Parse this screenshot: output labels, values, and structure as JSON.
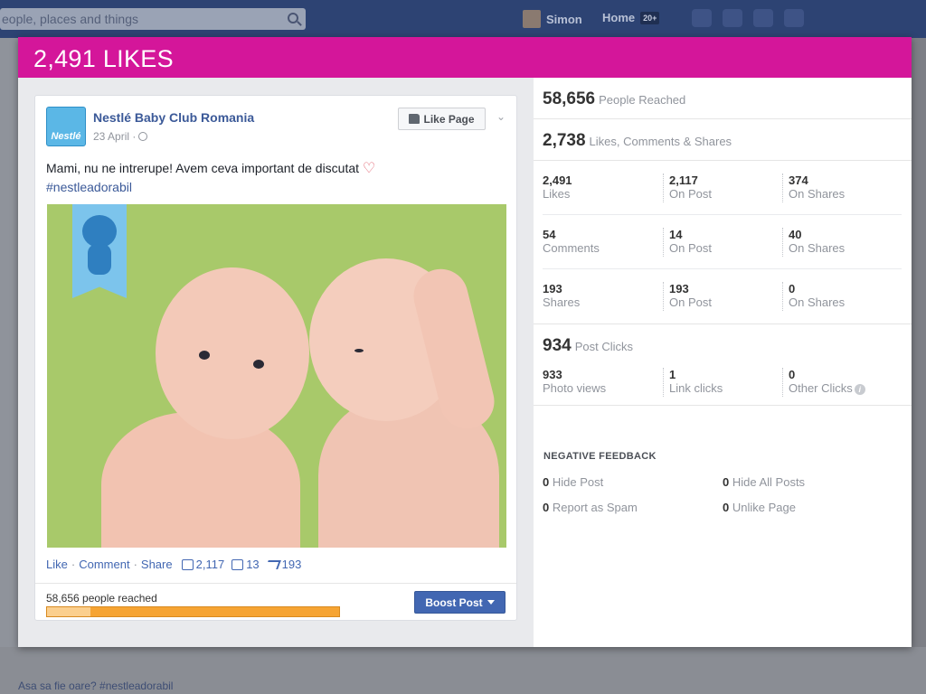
{
  "topbar": {
    "search_placeholder": "eople, places and things",
    "user_name": "Simon",
    "home_label": "Home",
    "home_badge": "20+"
  },
  "background": {
    "bottom_text": "Asa sa fie oare? #nestleadorabil"
  },
  "overlay": {
    "title": "2,491 LIKES"
  },
  "post": {
    "page_name": "Nestlé Baby Club Romania",
    "logo_text": "Nestlé",
    "date": "23 April ·",
    "like_page_label": "Like Page",
    "message": "Mami, nu ne intrerupe! Avem ceva important de discutat",
    "hashtag": "#nestleadorabil",
    "actions": {
      "like": "Like",
      "comment": "Comment",
      "share": "Share",
      "separator": "·",
      "like_count": "2,117",
      "comment_count": "13",
      "share_count": "193"
    },
    "reach_text": "58,656 people reached",
    "reach_organic_fraction": 0.15,
    "boost_label": "Boost Post"
  },
  "stats": {
    "people_reached": {
      "value": "58,656",
      "label": "People Reached"
    },
    "engagement": {
      "value": "2,738",
      "label": "Likes, Comments & Shares"
    },
    "likes": [
      {
        "value": "2,491",
        "label": "Likes"
      },
      {
        "value": "2,117",
        "label": "On Post"
      },
      {
        "value": "374",
        "label": "On Shares"
      }
    ],
    "comments": [
      {
        "value": "54",
        "label": "Comments"
      },
      {
        "value": "14",
        "label": "On Post"
      },
      {
        "value": "40",
        "label": "On Shares"
      }
    ],
    "shares": [
      {
        "value": "193",
        "label": "Shares"
      },
      {
        "value": "193",
        "label": "On Post"
      },
      {
        "value": "0",
        "label": "On Shares"
      }
    ],
    "post_clicks": {
      "value": "934",
      "label": "Post Clicks"
    },
    "clicks": [
      {
        "value": "933",
        "label": "Photo views"
      },
      {
        "value": "1",
        "label": "Link clicks"
      },
      {
        "value": "0",
        "label": "Other Clicks"
      }
    ],
    "negative_feedback": {
      "heading": "NEGATIVE FEEDBACK",
      "hide_post": {
        "value": "0",
        "label": "Hide Post"
      },
      "hide_all_posts": {
        "value": "0",
        "label": "Hide All Posts"
      },
      "report_spam": {
        "value": "0",
        "label": "Report as Spam"
      },
      "unlike_page": {
        "value": "0",
        "label": "Unlike Page"
      }
    }
  },
  "colors": {
    "header_magenta": "#d4169a",
    "facebook_blue": "#4267b2",
    "reach_bar": "#f6a433"
  }
}
